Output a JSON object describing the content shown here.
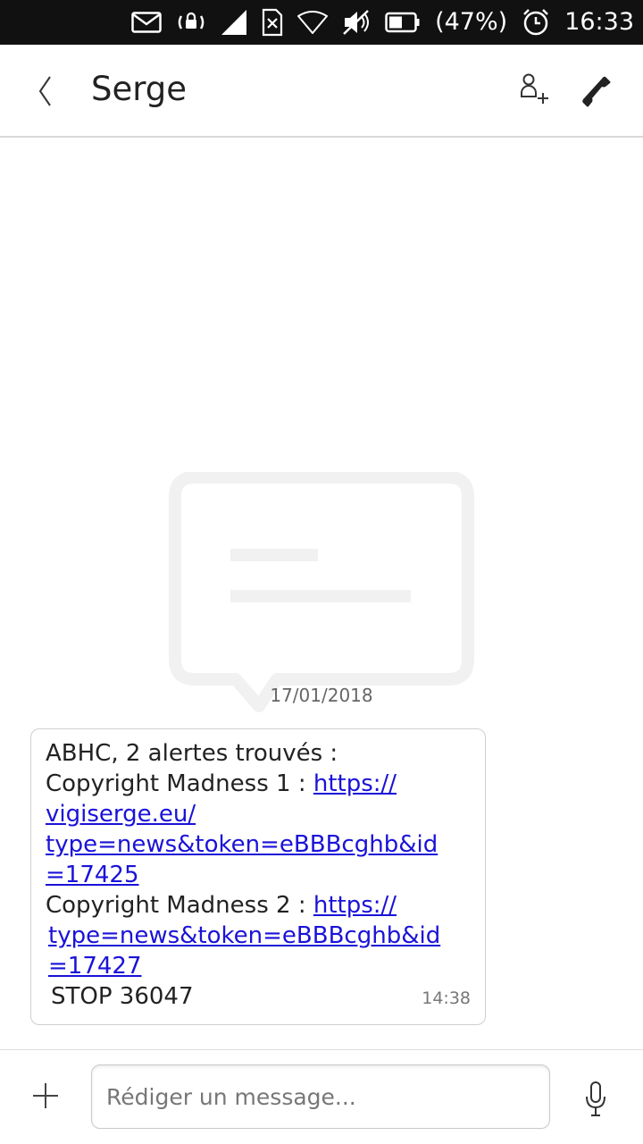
{
  "status_bar": {
    "battery_text": "(47%)",
    "time": "16:33",
    "icons": [
      "mail-icon",
      "rotation-lock-icon",
      "signal-icon",
      "no-sim-icon",
      "wifi-icon",
      "muted-icon",
      "battery-icon",
      "alarm-icon"
    ]
  },
  "header": {
    "title": "Serge",
    "back_icon": "chevron-left-icon",
    "add_contact_icon": "add-contact-icon",
    "call_icon": "phone-icon"
  },
  "conversation": {
    "date": "17/01/2018",
    "messages": [
      {
        "lines": [
          {
            "text": "ABHC, 2 alertes trouvés :"
          },
          {
            "text": "Copyright Madness 1 : ",
            "link": "https://"
          },
          {
            "link": "vigiserge.eu/"
          },
          {
            "link": "type=news&token=eBBBcghb&id"
          },
          {
            "link": "=17425"
          },
          {
            "text": "Copyright Madness 2 : ",
            "link": "https://"
          },
          {
            "link": "type=news&token=eBBBcghb&id"
          },
          {
            "link": "=17427"
          },
          {
            "text": "STOP 36047"
          }
        ],
        "time": "14:38"
      }
    ]
  },
  "composer": {
    "placeholder": "Rédiger un message...",
    "value": "",
    "attach_icon": "plus-icon",
    "mic_icon": "microphone-icon"
  }
}
